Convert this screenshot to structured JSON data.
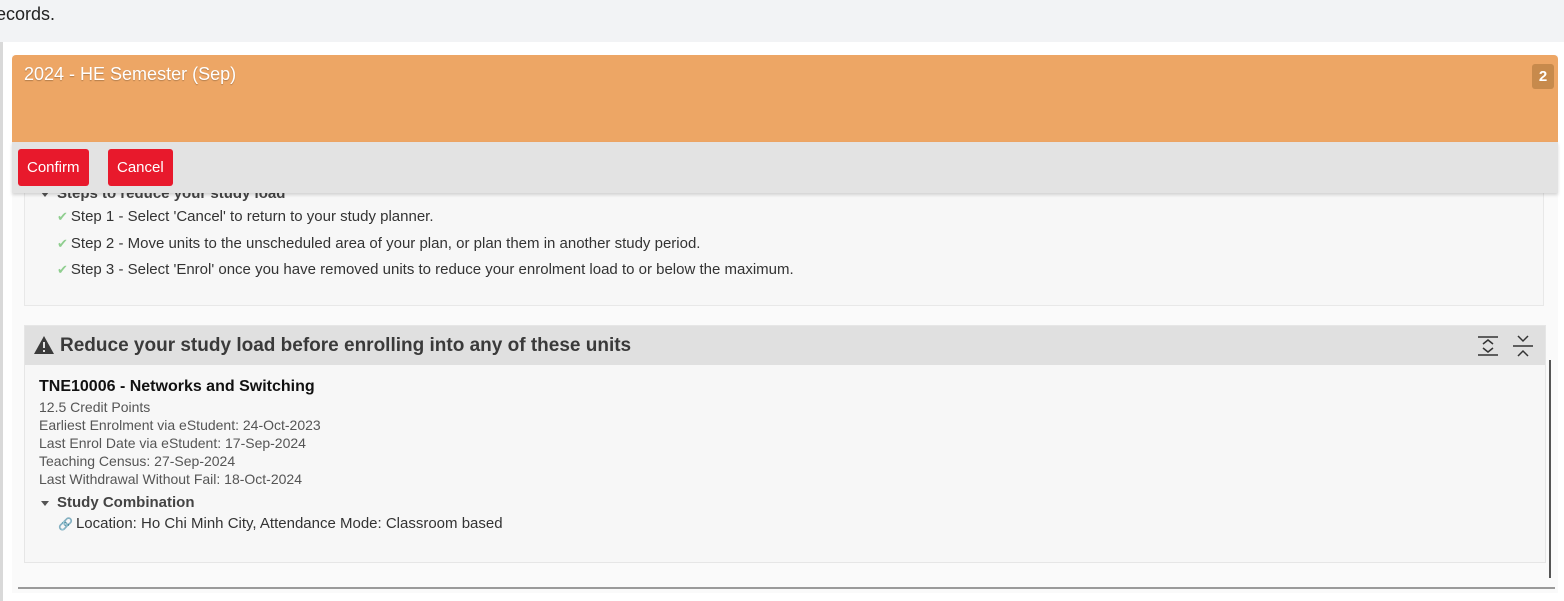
{
  "page": {
    "top_text": "ecords."
  },
  "semester": {
    "title": "2024 - HE Semester (Sep)",
    "count": "2"
  },
  "actions": {
    "confirm_label": "Confirm",
    "cancel_label": "Cancel"
  },
  "steps": {
    "heading": "Steps to reduce your study load",
    "items": [
      "Step 1 - Select 'Cancel' to return to your study planner.",
      "Step 2 - Move units to the unscheduled area of your plan, or plan them in another study period.",
      "Step 3 - Select 'Enrol' once you have removed units to reduce your enrolment load to or below the maximum."
    ]
  },
  "warning": {
    "title": "Reduce your study load before enrolling into any of these units",
    "icon": "warning-triangle-icon"
  },
  "unit": {
    "title": "TNE10006 - Networks and Switching",
    "credit_points": "12.5 Credit Points",
    "earliest_enrolment": "Earliest Enrolment via eStudent: 24-Oct-2023",
    "last_enrol": "Last Enrol Date via eStudent: 17-Sep-2024",
    "census": "Teaching Census: 27-Sep-2024",
    "last_withdrawal": "Last Withdrawal Without Fail: 18-Oct-2024",
    "combination_heading": "Study Combination",
    "combination_item": "Location: Ho Chi Minh City, Attendance Mode: Classroom based"
  },
  "colors": {
    "header": "#eda665",
    "button": "#e8192c",
    "check": "#8fce8f"
  }
}
